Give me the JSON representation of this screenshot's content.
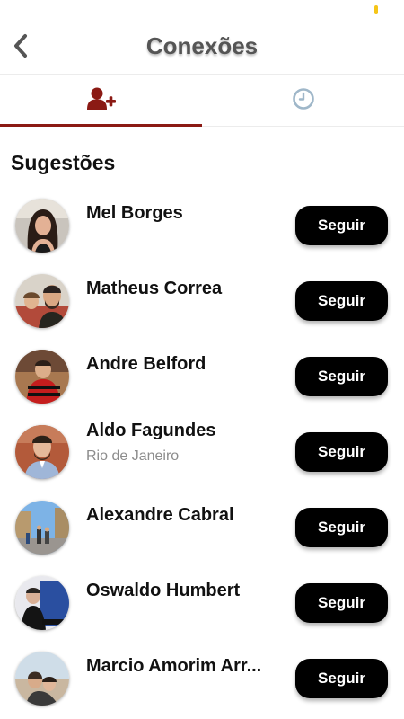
{
  "header": {
    "title": "Conexões"
  },
  "tabs": [
    {
      "icon": "add-user-icon",
      "active": true,
      "color": "#8b1a14"
    },
    {
      "icon": "clock-icon",
      "active": false,
      "color": "#9fb7c9"
    }
  ],
  "section": {
    "title": "Sugestões"
  },
  "suggestions": [
    {
      "name": "Mel Borges",
      "subtitle": "",
      "button": "Seguir"
    },
    {
      "name": "Matheus Correa",
      "subtitle": "",
      "button": "Seguir"
    },
    {
      "name": "Andre Belford",
      "subtitle": "",
      "button": "Seguir"
    },
    {
      "name": "Aldo Fagundes",
      "subtitle": "Rio de Janeiro",
      "button": "Seguir"
    },
    {
      "name": "Alexandre Cabral",
      "subtitle": "",
      "button": "Seguir"
    },
    {
      "name": "Oswaldo Humbert",
      "subtitle": "",
      "button": "Seguir"
    },
    {
      "name": "Marcio Amorim Arr...",
      "subtitle": "",
      "button": "Seguir"
    }
  ],
  "colors": {
    "accent": "#8b1a14",
    "button_bg": "#000000"
  }
}
